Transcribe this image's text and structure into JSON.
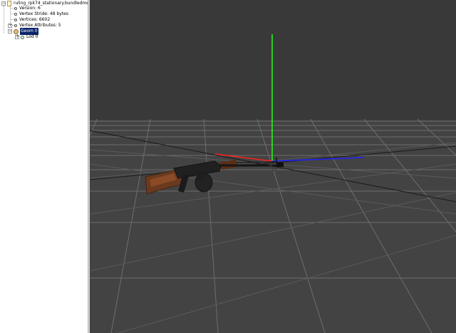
{
  "tree": {
    "root": {
      "label": "ruling_rpk74_stationary.bundledmesh"
    },
    "items": [
      {
        "label": "Version: 6"
      },
      {
        "label": "Vertex Stride: 48 bytes"
      },
      {
        "label": "Vertices: 6602"
      },
      {
        "label": "Vertex Attributes: 5"
      }
    ],
    "geom": {
      "label": "Geom 0"
    },
    "lod": {
      "label": "Lod 0"
    }
  },
  "viewport": {
    "background_color": "#434343",
    "sky_color": "#393939",
    "grid_color": "#6e6e6e",
    "axis_colors": {
      "x": "#ff2020",
      "y": "#20ff20",
      "z": "#2020ff"
    },
    "model_icon": "rpk74-machine-gun-model"
  }
}
